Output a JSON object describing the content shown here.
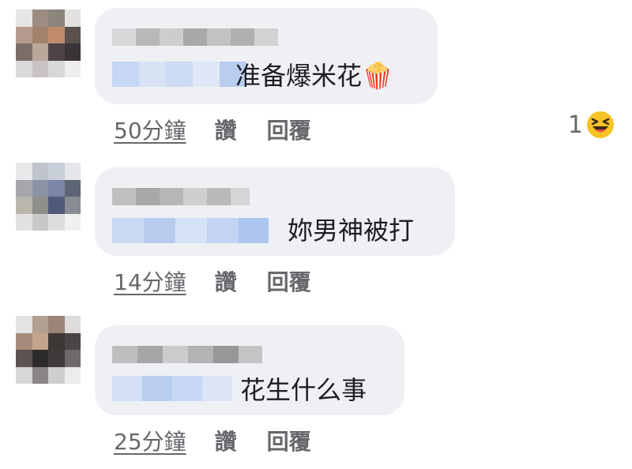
{
  "comments": [
    {
      "text": "准备爆米花",
      "emoji": "🍿",
      "time": "50分鐘",
      "like": "讚",
      "reply": "回覆",
      "reaction_count": "1",
      "reaction_icon": "laughing-squint-emoji"
    },
    {
      "text": "妳男神被打",
      "time": "14分鐘",
      "like": "讚",
      "reply": "回覆"
    },
    {
      "text": "花生什么事",
      "time": "25分鐘",
      "like": "讚",
      "reply": "回覆"
    }
  ],
  "colors": {
    "bubble": "#eef0f4",
    "text": "#1c1e21",
    "meta": "#65676b",
    "reaction_yellow": "#f7c325"
  }
}
